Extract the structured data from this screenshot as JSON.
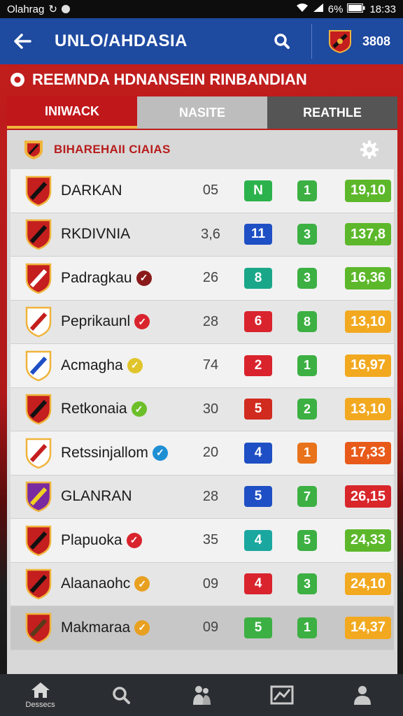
{
  "status_bar": {
    "carrier": "Olahrag",
    "battery": "6%",
    "time": "18:33"
  },
  "app_bar": {
    "title": "UNLO/AHDASIA",
    "count": "3808"
  },
  "section": {
    "title": "REEMNDA HDNANSEIN RINBANDIAN"
  },
  "tabs": [
    {
      "label": "INIWACK"
    },
    {
      "label": "NASITE"
    },
    {
      "label": "REATHLE"
    }
  ],
  "panel": {
    "title": "BIHAREHAII  CIAIAS"
  },
  "colors": {
    "green": "#2bb24c",
    "blue": "#1f4fc4",
    "teal": "#1aa7a0",
    "red": "#d9232d",
    "orange": "#e8731a",
    "lime": "#5cb82a",
    "amber": "#f2a91f",
    "crimson": "#d8262a",
    "yellow_check": "#e0c42a"
  },
  "rows": [
    {
      "name": "DARKAN",
      "check": "",
      "pts": "05",
      "b1": "N",
      "b1_color": "#2bb24c",
      "b2": "1",
      "b2_color": "#3cb043",
      "b3": "19,10",
      "b3_color": "#5cb82a"
    },
    {
      "name": "RKDIVNIA",
      "check": "",
      "pts": "3,6",
      "b1": "11",
      "b1_color": "#1f4fc4",
      "b2": "3",
      "b2_color": "#3cb043",
      "b3": "137,8",
      "b3_color": "#5cb82a"
    },
    {
      "name": "Padragkau",
      "check": "dark",
      "pts": "26",
      "b1": "8",
      "b1_color": "#1aa789",
      "b2": "3",
      "b2_color": "#3cb043",
      "b3": "16,36",
      "b3_color": "#5cb82a"
    },
    {
      "name": "Peprikaunl",
      "check": "red",
      "pts": "28",
      "b1": "6",
      "b1_color": "#d9232d",
      "b2": "8",
      "b2_color": "#3cb043",
      "b3": "13,10",
      "b3_color": "#f2a91f"
    },
    {
      "name": "Acmagha",
      "check": "yellow",
      "pts": "74",
      "b1": "2",
      "b1_color": "#d9232d",
      "b2": "1",
      "b2_color": "#3cb043",
      "b3": "16,97",
      "b3_color": "#f2a91f"
    },
    {
      "name": "Retkonaia",
      "check": "green",
      "pts": "30",
      "b1": "5",
      "b1_color": "#d12a1e",
      "b2": "2",
      "b2_color": "#3cb043",
      "b3": "13,10",
      "b3_color": "#f2a91f"
    },
    {
      "name": "Retssinjallom",
      "check": "blue",
      "pts": "20",
      "b1": "4",
      "b1_color": "#1f4fc4",
      "b2": "1",
      "b2_color": "#e8731a",
      "b3": "17,33",
      "b3_color": "#e85a1a"
    },
    {
      "name": "GLANRAN",
      "check": "",
      "pts": "28",
      "b1": "5",
      "b1_color": "#1f4fc4",
      "b2": "7",
      "b2_color": "#3cb043",
      "b3": "26,15",
      "b3_color": "#d8262a"
    },
    {
      "name": "Plapuoka",
      "check": "red",
      "pts": "35",
      "b1": "4",
      "b1_color": "#1aa7a0",
      "b2": "5",
      "b2_color": "#3cb043",
      "b3": "24,33",
      "b3_color": "#5cb82a"
    },
    {
      "name": "Alaanaohc",
      "check": "orange",
      "pts": "09",
      "b1": "4",
      "b1_color": "#d9232d",
      "b2": "3",
      "b2_color": "#3cb043",
      "b3": "24,10",
      "b3_color": "#f2a91f"
    },
    {
      "name": "Makmaraa",
      "check": "orange",
      "pts": "09",
      "b1": "5",
      "b1_color": "#3cb043",
      "b2": "1",
      "b2_color": "#3cb043",
      "b3": "14,37",
      "b3_color": "#f2a91f"
    }
  ],
  "bottom_nav": [
    {
      "icon": "home-icon",
      "label": "Dessecs"
    },
    {
      "icon": "search-icon",
      "label": ""
    },
    {
      "icon": "players-icon",
      "label": ""
    },
    {
      "icon": "chart-icon",
      "label": ""
    },
    {
      "icon": "profile-icon",
      "label": ""
    }
  ]
}
